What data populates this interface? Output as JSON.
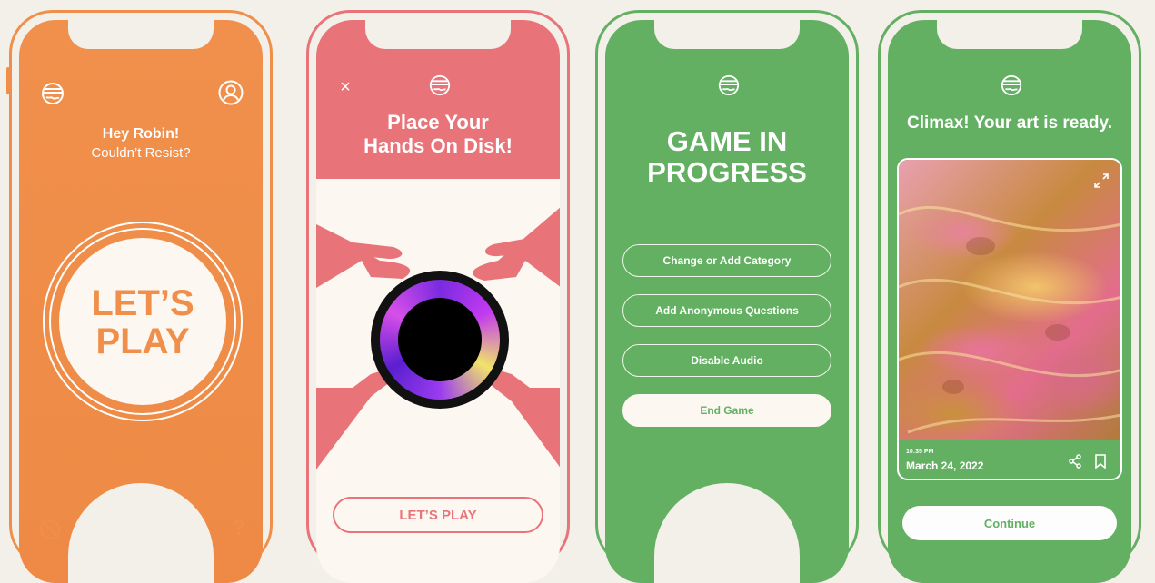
{
  "colors": {
    "bg": "#f3efe9",
    "orange": "#f08f4a",
    "orange_dark": "#eb8942",
    "pink": "#e8747a",
    "pink_dark": "#e26f75",
    "green": "#63b063",
    "green_dark": "#5dab5d"
  },
  "screen1": {
    "greeting": "Hey Robin!",
    "subtitle": "Couldn’t Resist?",
    "play_line1": "LET’S",
    "play_line2": "PLAY",
    "help": "?",
    "icons": {
      "logo": "globe-helmet-icon",
      "profile": "user-icon",
      "sound": "no-sound-icon"
    }
  },
  "screen2": {
    "close": "×",
    "title_line1": "Place Your",
    "title_line2": "Hands On Disk!",
    "button": "LET’S PLAY"
  },
  "screen3": {
    "title_line1": "GAME IN",
    "title_line2": "PROGRESS",
    "buttons": [
      "Change or Add Category",
      "Add Anonymous Questions",
      "Disable Audio",
      "End Game"
    ],
    "help": "?"
  },
  "screen4": {
    "title": "Climax! Your art is ready.",
    "time": "10:35 PM",
    "date": "March 24, 2022",
    "button": "Continue"
  }
}
